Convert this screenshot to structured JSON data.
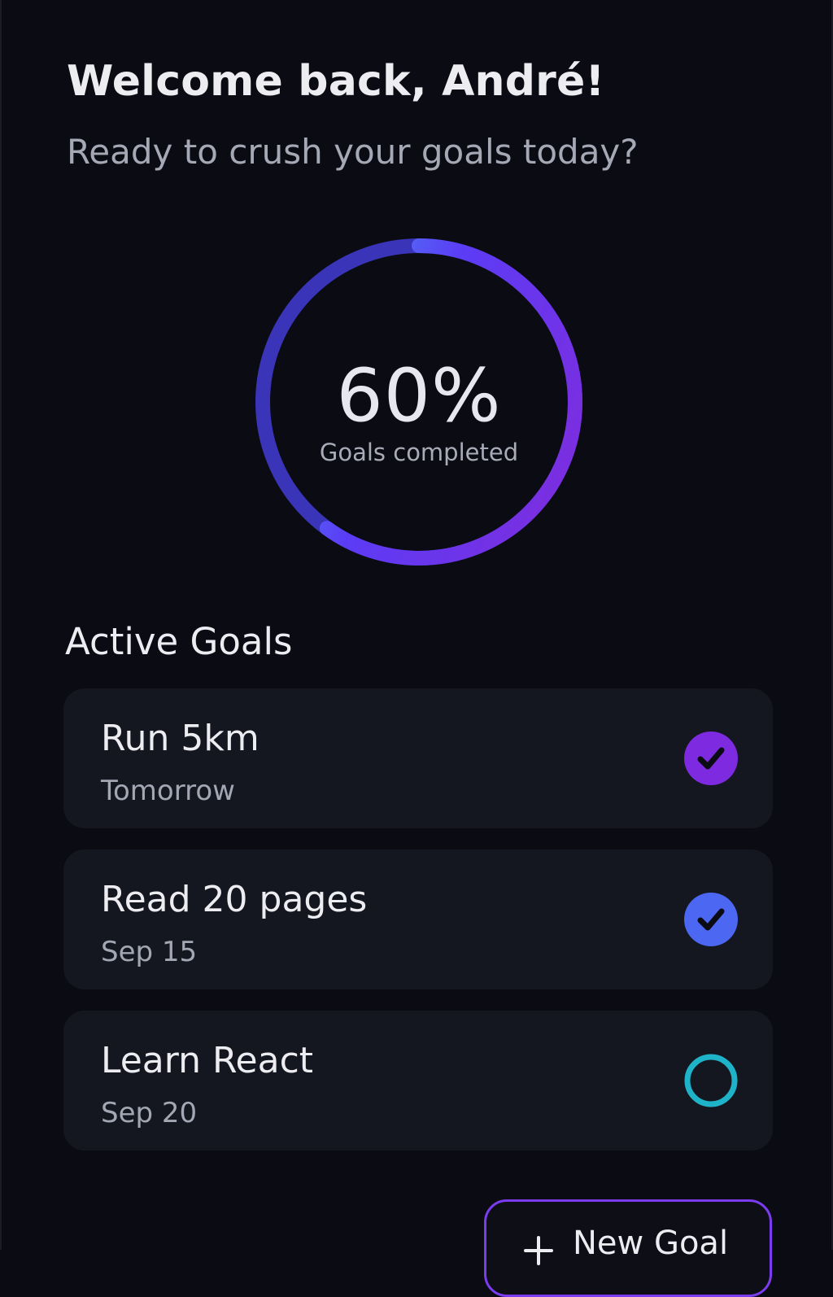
{
  "header": {
    "greeting": "Welcome back, André!",
    "subtitle": "Ready to crush your goals today?"
  },
  "progress": {
    "value": 60,
    "display": "60%",
    "label": "Goals completed",
    "gradient_colors": [
      "#4aa3f5",
      "#5b3cf5",
      "#7b2ee0"
    ]
  },
  "goals_section": {
    "title": "Active Goals"
  },
  "goals": [
    {
      "title": "Run 5km",
      "date": "Tomorrow",
      "status": "completed",
      "status_icon": "check-circle-icon",
      "color": "#7d2ae0"
    },
    {
      "title": "Read 20 pages",
      "date": "Sep 15",
      "status": "completed",
      "status_icon": "check-circle-icon",
      "color": "#4c67f2"
    },
    {
      "title": "Learn React",
      "date": "Sep 20",
      "status": "pending",
      "status_icon": "empty-circle-icon",
      "color": "#1fb3c9"
    }
  ],
  "actions": {
    "new_goal_label": "New Goal",
    "new_goal_icon": "plus-icon",
    "accent": "#7b3cf0"
  }
}
